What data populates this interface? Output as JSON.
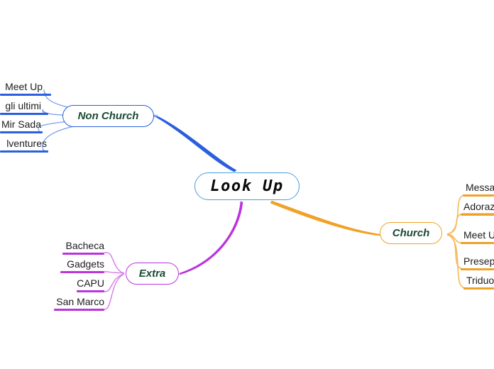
{
  "diagram": {
    "title": "Look Up",
    "type": "mind-map",
    "colors": {
      "root_border": "#4a9fdc",
      "root_text": "#0a0a0a",
      "branch_text": "#1a4a32",
      "leaf_text": "#1c1c1c",
      "non_church": "#2b5fdd",
      "church": "#f0a227",
      "extra": "#bb33dd",
      "background": "#ffffff"
    }
  },
  "root": {
    "label": "Look  Up"
  },
  "branches": [
    {
      "id": "non-church",
      "label": "Non Church",
      "color": "#2b5fdd",
      "side": "left",
      "leaves": [
        {
          "label": "Meet Up"
        },
        {
          "label": "gli ultimi"
        },
        {
          "label": "Mir Sada"
        },
        {
          "label": "lventures"
        }
      ]
    },
    {
      "id": "church",
      "label": "Church",
      "color": "#f0a227",
      "side": "right",
      "leaves": [
        {
          "label": "Messa"
        },
        {
          "label": "Adoraz"
        },
        {
          "label": "Meet U"
        },
        {
          "label": "Presep"
        },
        {
          "label": "Triduo"
        }
      ]
    },
    {
      "id": "extra",
      "label": "Extra",
      "color": "#bb33dd",
      "side": "left",
      "leaves": [
        {
          "label": "Bacheca"
        },
        {
          "label": "Gadgets"
        },
        {
          "label": "CAPU"
        },
        {
          "label": "San Marco"
        }
      ]
    }
  ]
}
